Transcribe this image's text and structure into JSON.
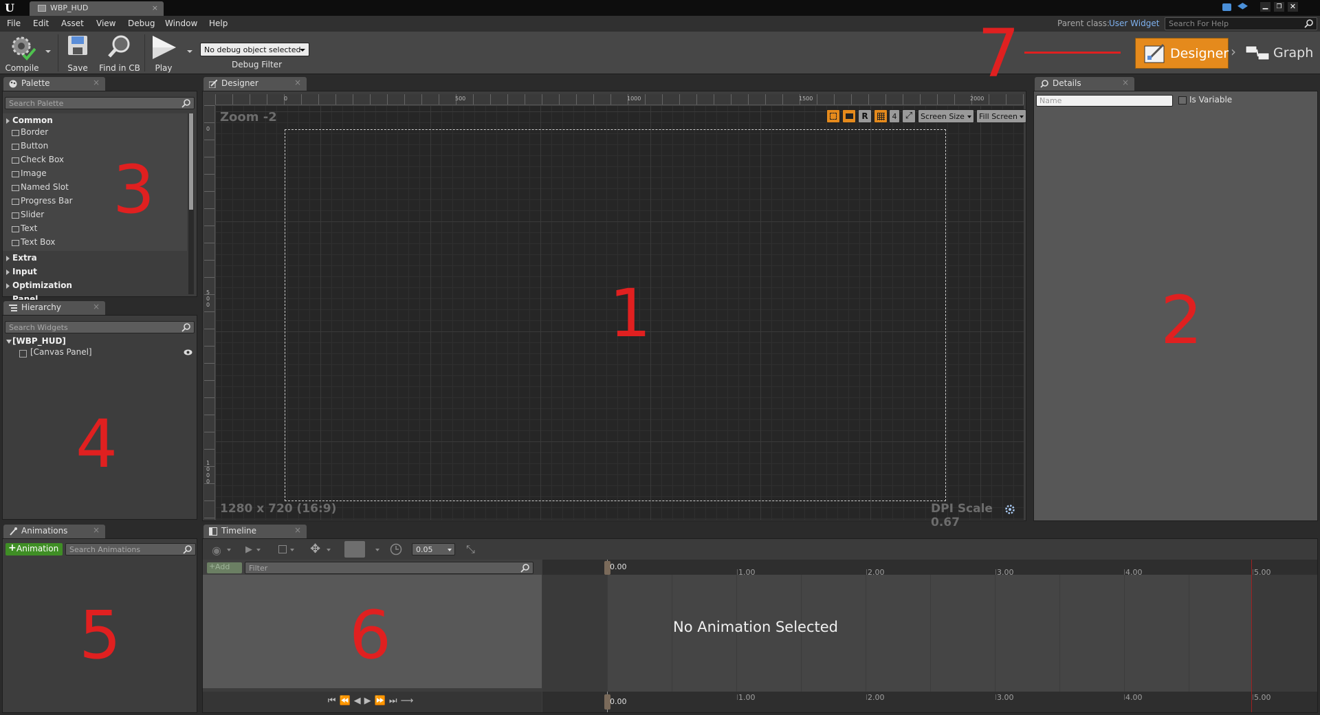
{
  "window": {
    "tab_title": "WBP_HUD",
    "parent_class_label": "Parent class:",
    "parent_class_value": "User Widget",
    "help_search_placeholder": "Search For Help"
  },
  "menu": [
    "File",
    "Edit",
    "Asset",
    "View",
    "Debug",
    "Window",
    "Help"
  ],
  "toolbar": {
    "compile": "Compile",
    "save": "Save",
    "find_in_cb": "Find in CB",
    "play": "Play",
    "debug_select": "No debug object selected",
    "debug_filter": "Debug Filter"
  },
  "modes": {
    "designer": "Designer",
    "graph": "Graph"
  },
  "palette": {
    "tab": "Palette",
    "search_placeholder": "Search Palette",
    "common_label": "Common",
    "common_items": [
      "Border",
      "Button",
      "Check Box",
      "Image",
      "Named Slot",
      "Progress Bar",
      "Slider",
      "Text",
      "Text Box"
    ],
    "other_categories": [
      "Extra",
      "Input",
      "Optimization",
      "Panel"
    ]
  },
  "hierarchy": {
    "tab": "Hierarchy",
    "search_placeholder": "Search Widgets",
    "root": "[WBP_HUD]",
    "child": "[Canvas Panel]"
  },
  "designer": {
    "tab": "Designer",
    "zoom": "Zoom -2",
    "ruler_top": [
      "0",
      "500",
      "1000",
      "1500",
      "2000"
    ],
    "ruler_left": [
      "0",
      "5\n0\n0",
      "1\n0\n0\n0"
    ],
    "btn_r": "R",
    "btn_grid_size": "4",
    "screen_size": "Screen Size",
    "fill_screen": "Fill Screen",
    "resolution": "1280 x 720 (16:9)",
    "dpi": "DPI Scale 0.67"
  },
  "details": {
    "tab": "Details",
    "name_placeholder": "Name",
    "is_variable": "Is Variable"
  },
  "animations": {
    "tab": "Animations",
    "add_button": "Animation",
    "search_placeholder": "Search Animations"
  },
  "timeline": {
    "tab": "Timeline",
    "step_value": "0.05",
    "add_button": "Add",
    "filter_placeholder": "Filter",
    "empty_message": "No Animation Selected",
    "time_marks": [
      "0.00",
      "1.00",
      "2.00",
      "3.00",
      "4.00",
      "5.00"
    ]
  },
  "annotations": [
    "1",
    "2",
    "3",
    "4",
    "5",
    "6",
    "7"
  ],
  "colors": {
    "accent_orange": "#e58a1c",
    "annotation_red": "#e02020",
    "add_green": "#4a9a2a"
  }
}
